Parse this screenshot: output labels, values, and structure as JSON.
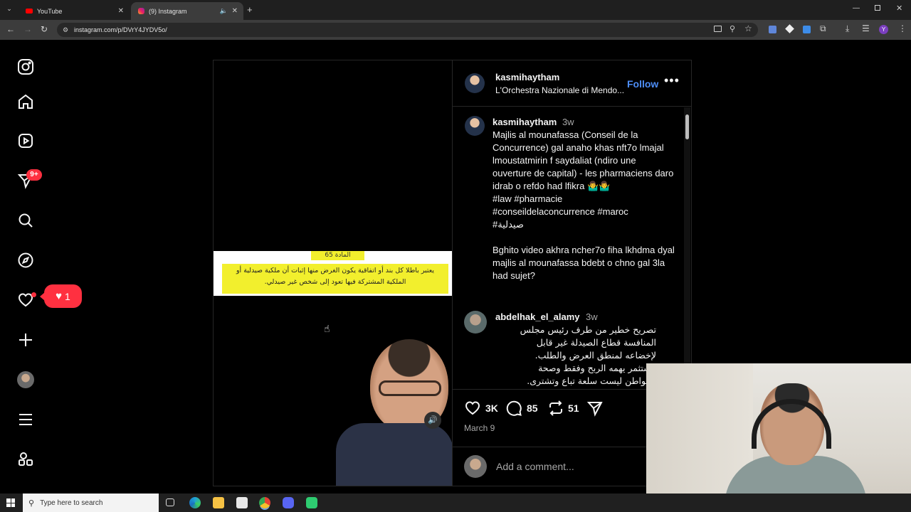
{
  "tabs": [
    {
      "label": "YouTube",
      "icon": "youtube-icon"
    },
    {
      "label": "(9) Instagram",
      "icon": "instagram-icon"
    }
  ],
  "url": "instagram.com/p/DVrY4JYDV5o/",
  "sidebar": {
    "notification_badge": "9+",
    "likes_bubble_count": "1"
  },
  "post": {
    "header_username": "kasmihaytham",
    "header_audio": "L'Orchestra Nazionale di Mendo...",
    "follow_label": "Follow",
    "image_caption_title": "المادة 65",
    "image_caption_text": "يعتبر باطلا كل بند أو اتفاقية يكون الغرض منها إثبات أن ملكية صيدلية أو الملكية المشتركة فيها تعود إلى شخص غير صيدلي."
  },
  "caption": {
    "username": "kasmihaytham",
    "time": "3w",
    "text": "Majlis al mounafassa (Conseil de la Concurrence) gal anaho khas nft7o lmajal lmoustatmirin f saydaliat (ndiro une ouverture de capital) - les pharmaciens daro idrab o refdo had lfikra 🤷‍♂️🤷‍♂️",
    "hashtags_line1": "#law #pharmacie",
    "hashtags_line2": "#conseildelaconcurrence #maroc",
    "hashtags_line3": "#صيدلية",
    "text2": "Bghito video akhra ncher7o fiha lkhdma dyal majlis al mounafassa bdebt o chno gal 3la had sujet?"
  },
  "comment": {
    "username": "abdelhak_el_alamy",
    "time": "3w",
    "lines": [
      "تصريح خطير من طرف رئيس مجلس",
      "المنافسة قطاع الصيدلة غير قابل",
      "لإخضاعه لمنطق العرض والطلب.",
      "مستثمر يهمه الربح وفقط وصحة",
      "المواطن ليست سلعة تباع وتشترى."
    ]
  },
  "actions": {
    "likes": "3K",
    "comments": "85",
    "reposts": "51",
    "date": "March 9",
    "add_comment_placeholder": "Add a comment..."
  },
  "taskbar": {
    "search_placeholder": "Type here to search"
  },
  "colors": {
    "accent_blue": "#4d8df6",
    "notification_red": "#ff3040",
    "highlight_yellow": "#f2ef2d"
  }
}
